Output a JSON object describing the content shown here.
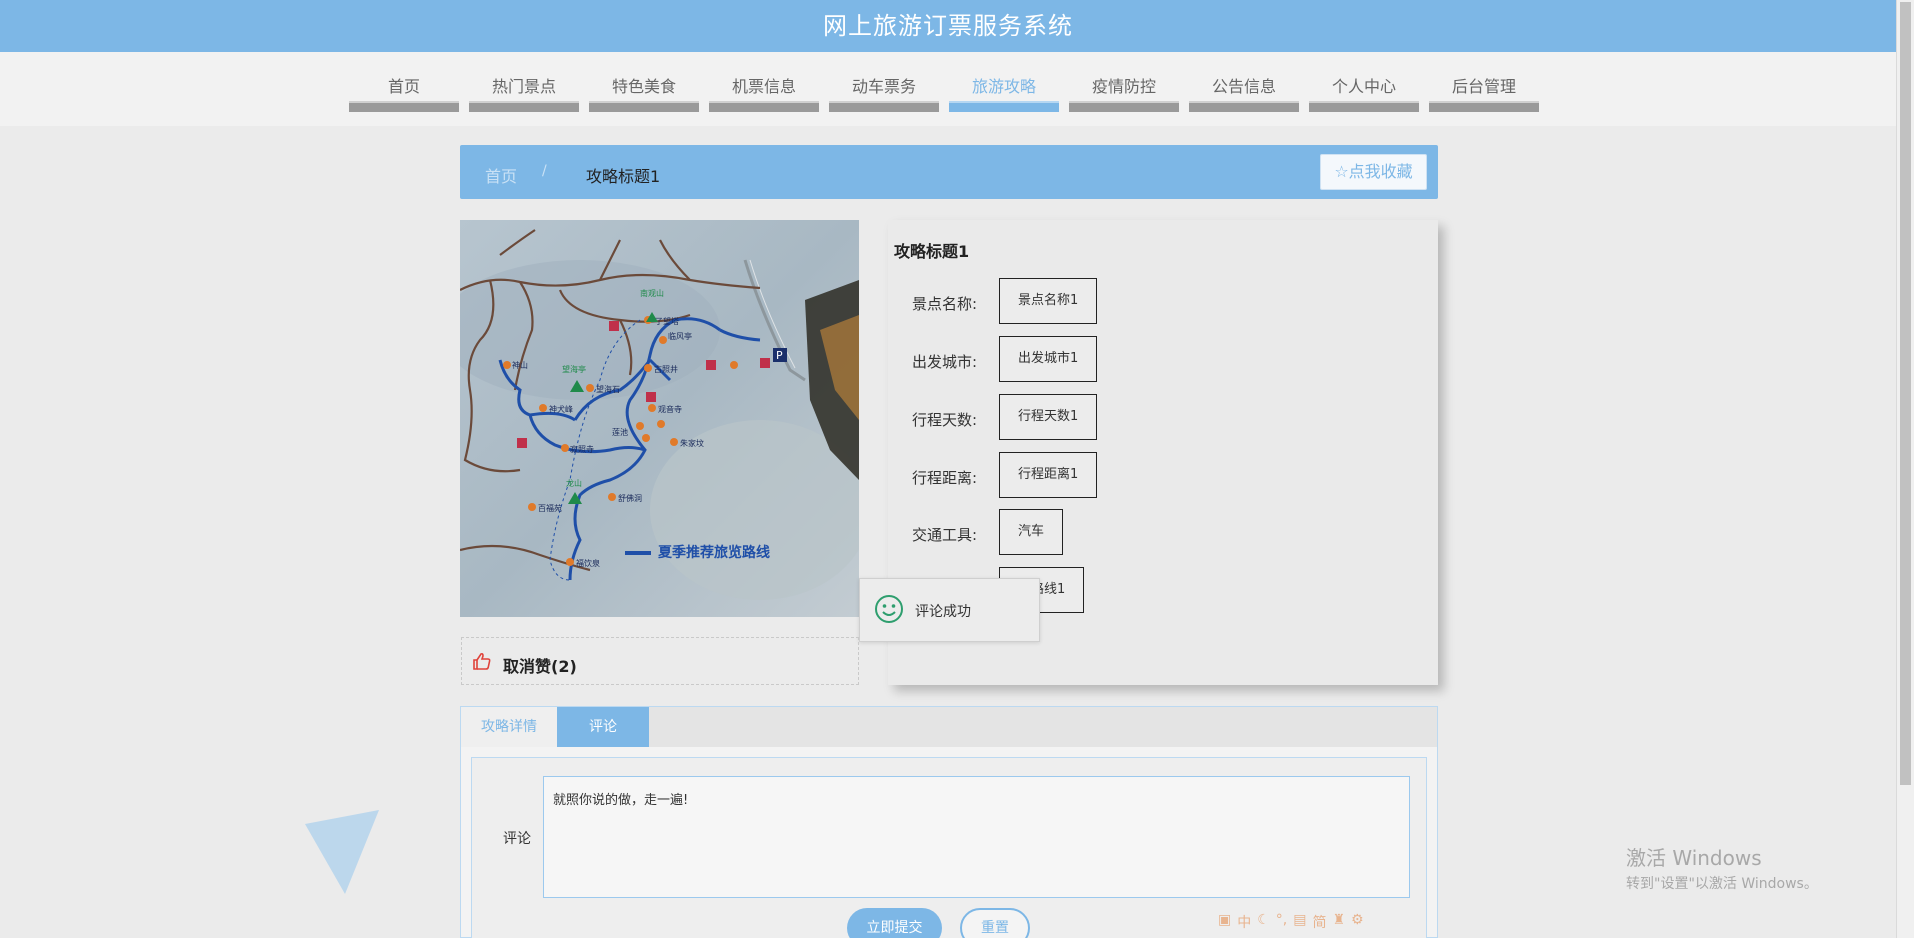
{
  "header": {
    "title": "网上旅游订票服务系统"
  },
  "nav": {
    "items": [
      {
        "label": "首页",
        "active": false
      },
      {
        "label": "热门景点",
        "active": false
      },
      {
        "label": "特色美食",
        "active": false
      },
      {
        "label": "机票信息",
        "active": false
      },
      {
        "label": "动车票务",
        "active": false
      },
      {
        "label": "旅游攻略",
        "active": true
      },
      {
        "label": "疫情防控",
        "active": false
      },
      {
        "label": "公告信息",
        "active": false
      },
      {
        "label": "个人中心",
        "active": false
      },
      {
        "label": "后台管理",
        "active": false
      }
    ]
  },
  "breadcrumb": {
    "home": "首页",
    "separator": "/",
    "current": "攻略标题1"
  },
  "favorite_button": {
    "label": "点我收藏",
    "icon": "star-outline-icon"
  },
  "map": {
    "legend": "夏季推荐旅览路线",
    "places": [
      "南观山",
      "了望塔",
      "临风亭",
      "神山",
      "望海亭",
      "望海石",
      "古照井",
      "神犬峰",
      "观音寺",
      "莲池",
      "朱家坟",
      "龙山",
      "舒佛洞",
      "百福苑",
      "福饮泉",
      "寂照寺"
    ]
  },
  "detail": {
    "title": "攻略标题1",
    "rows": [
      {
        "label": "景点名称:",
        "value": "景点名称1"
      },
      {
        "label": "出发城市:",
        "value": "出发城市1"
      },
      {
        "label": "行程天数:",
        "value": "行程天数1"
      },
      {
        "label": "行程距离:",
        "value": "行程距离1"
      },
      {
        "label": "交通工具:",
        "value": "汽车"
      },
      {
        "label": "",
        "value": "程路线1"
      }
    ]
  },
  "toast": {
    "message": "评论成功",
    "icon": "smile-icon"
  },
  "like": {
    "label": "取消赞(2)",
    "icon": "thumbs-up-icon"
  },
  "tabs": {
    "detail": "攻略详情",
    "comment": "评论",
    "active": "comment"
  },
  "comment_form": {
    "label": "评论",
    "value": "就照你说的做，走一遍!",
    "submit": "立即提交",
    "reset": "重置"
  },
  "watermark": {
    "line1": "激活 Windows",
    "line2": "转到\"设置\"以激活 Windows。"
  },
  "tray": {
    "items": [
      "中",
      "简"
    ]
  },
  "colors": {
    "accent": "#7db7e6",
    "background": "#ebebeb",
    "toast_icon": "#2e9e6e",
    "like_icon": "#e0423a"
  }
}
